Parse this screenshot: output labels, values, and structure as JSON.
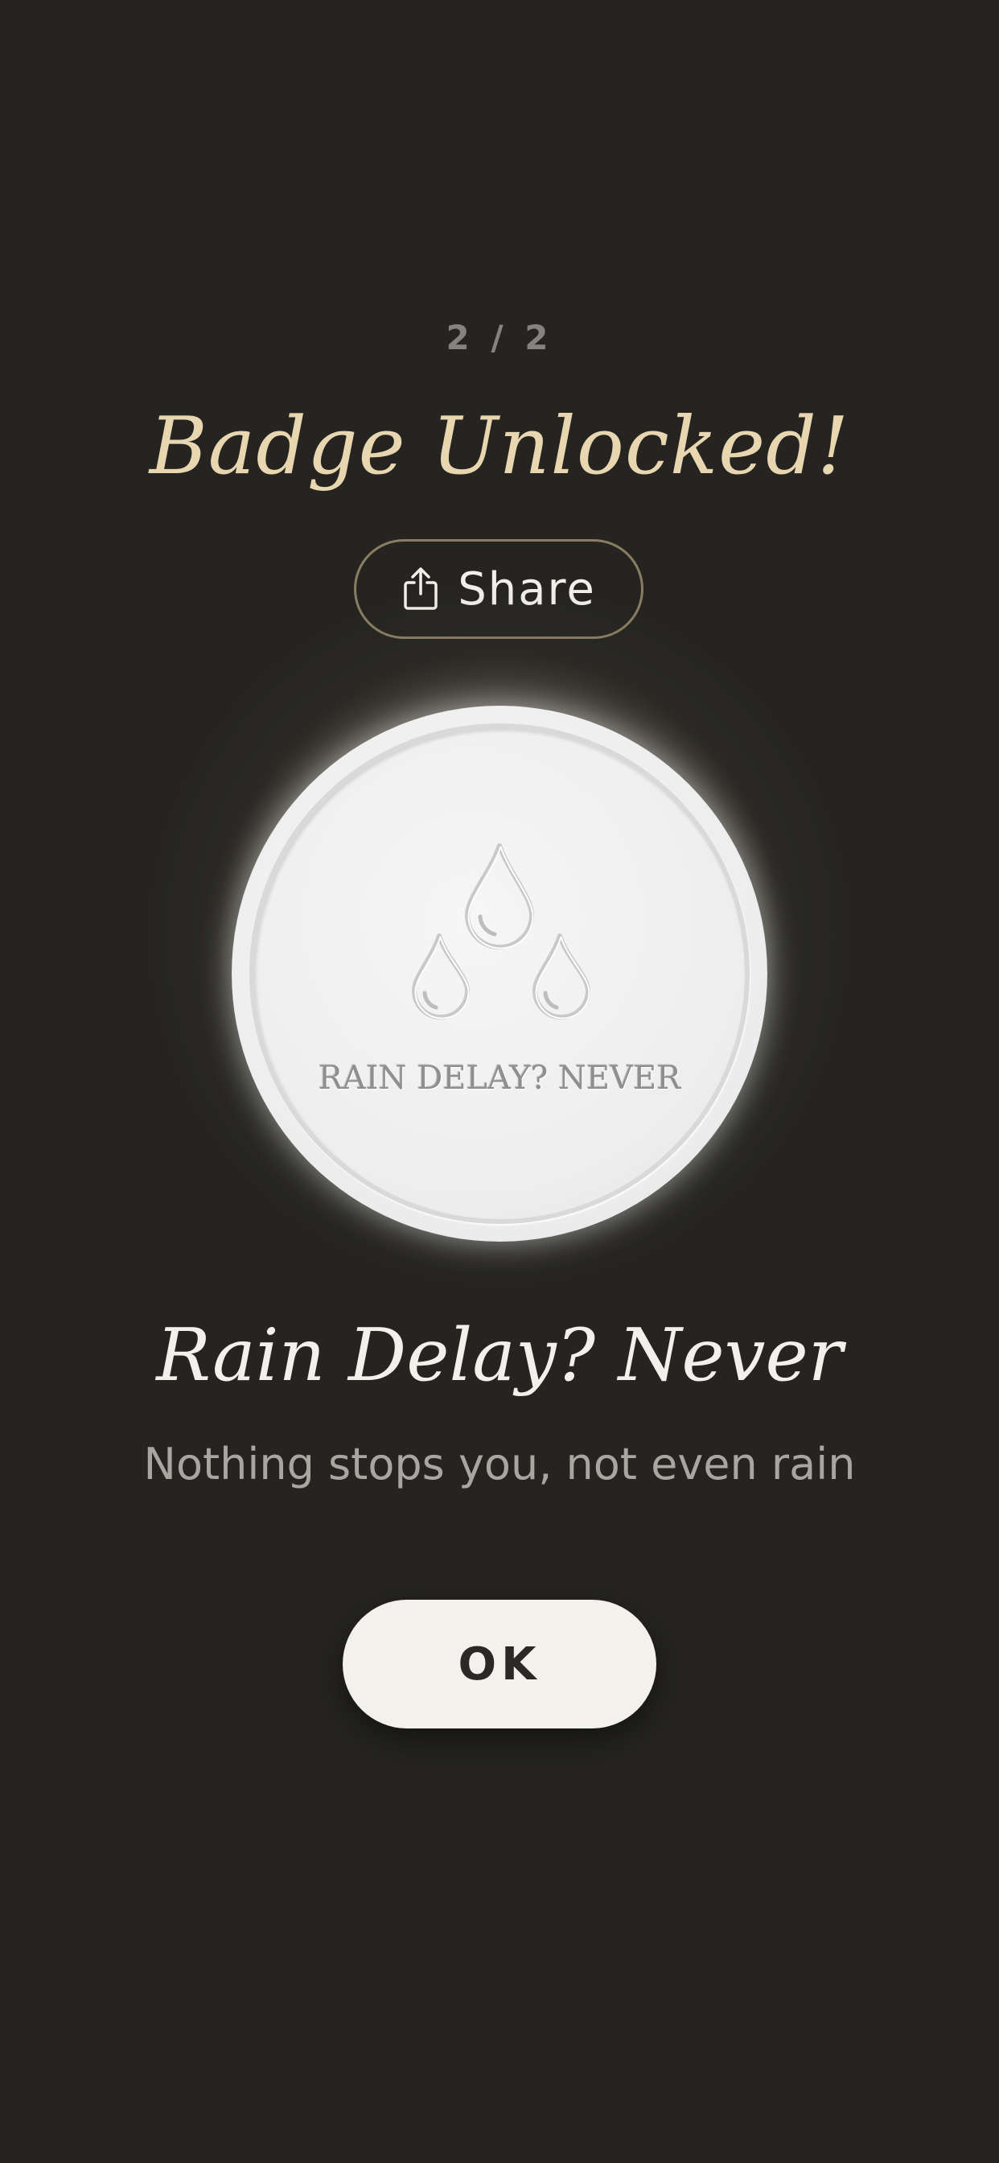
{
  "progress": {
    "counter": "2 / 2"
  },
  "header": {
    "title": "Badge Unlocked!"
  },
  "share": {
    "label": "Share",
    "icon": "share-icon"
  },
  "badge": {
    "emblem_icon": "raindrops-icon",
    "inscription": "RAIN DELAY? NEVER",
    "name": "Rain Delay? Never",
    "description": "Nothing stops you, not even rain"
  },
  "actions": {
    "ok_label": "OK"
  },
  "colors": {
    "background": "#252420",
    "title_gold": "#e8d6b0",
    "badge_white": "#eeeeee",
    "button_light": "#f3f1ec",
    "share_border": "#8a7d63"
  }
}
